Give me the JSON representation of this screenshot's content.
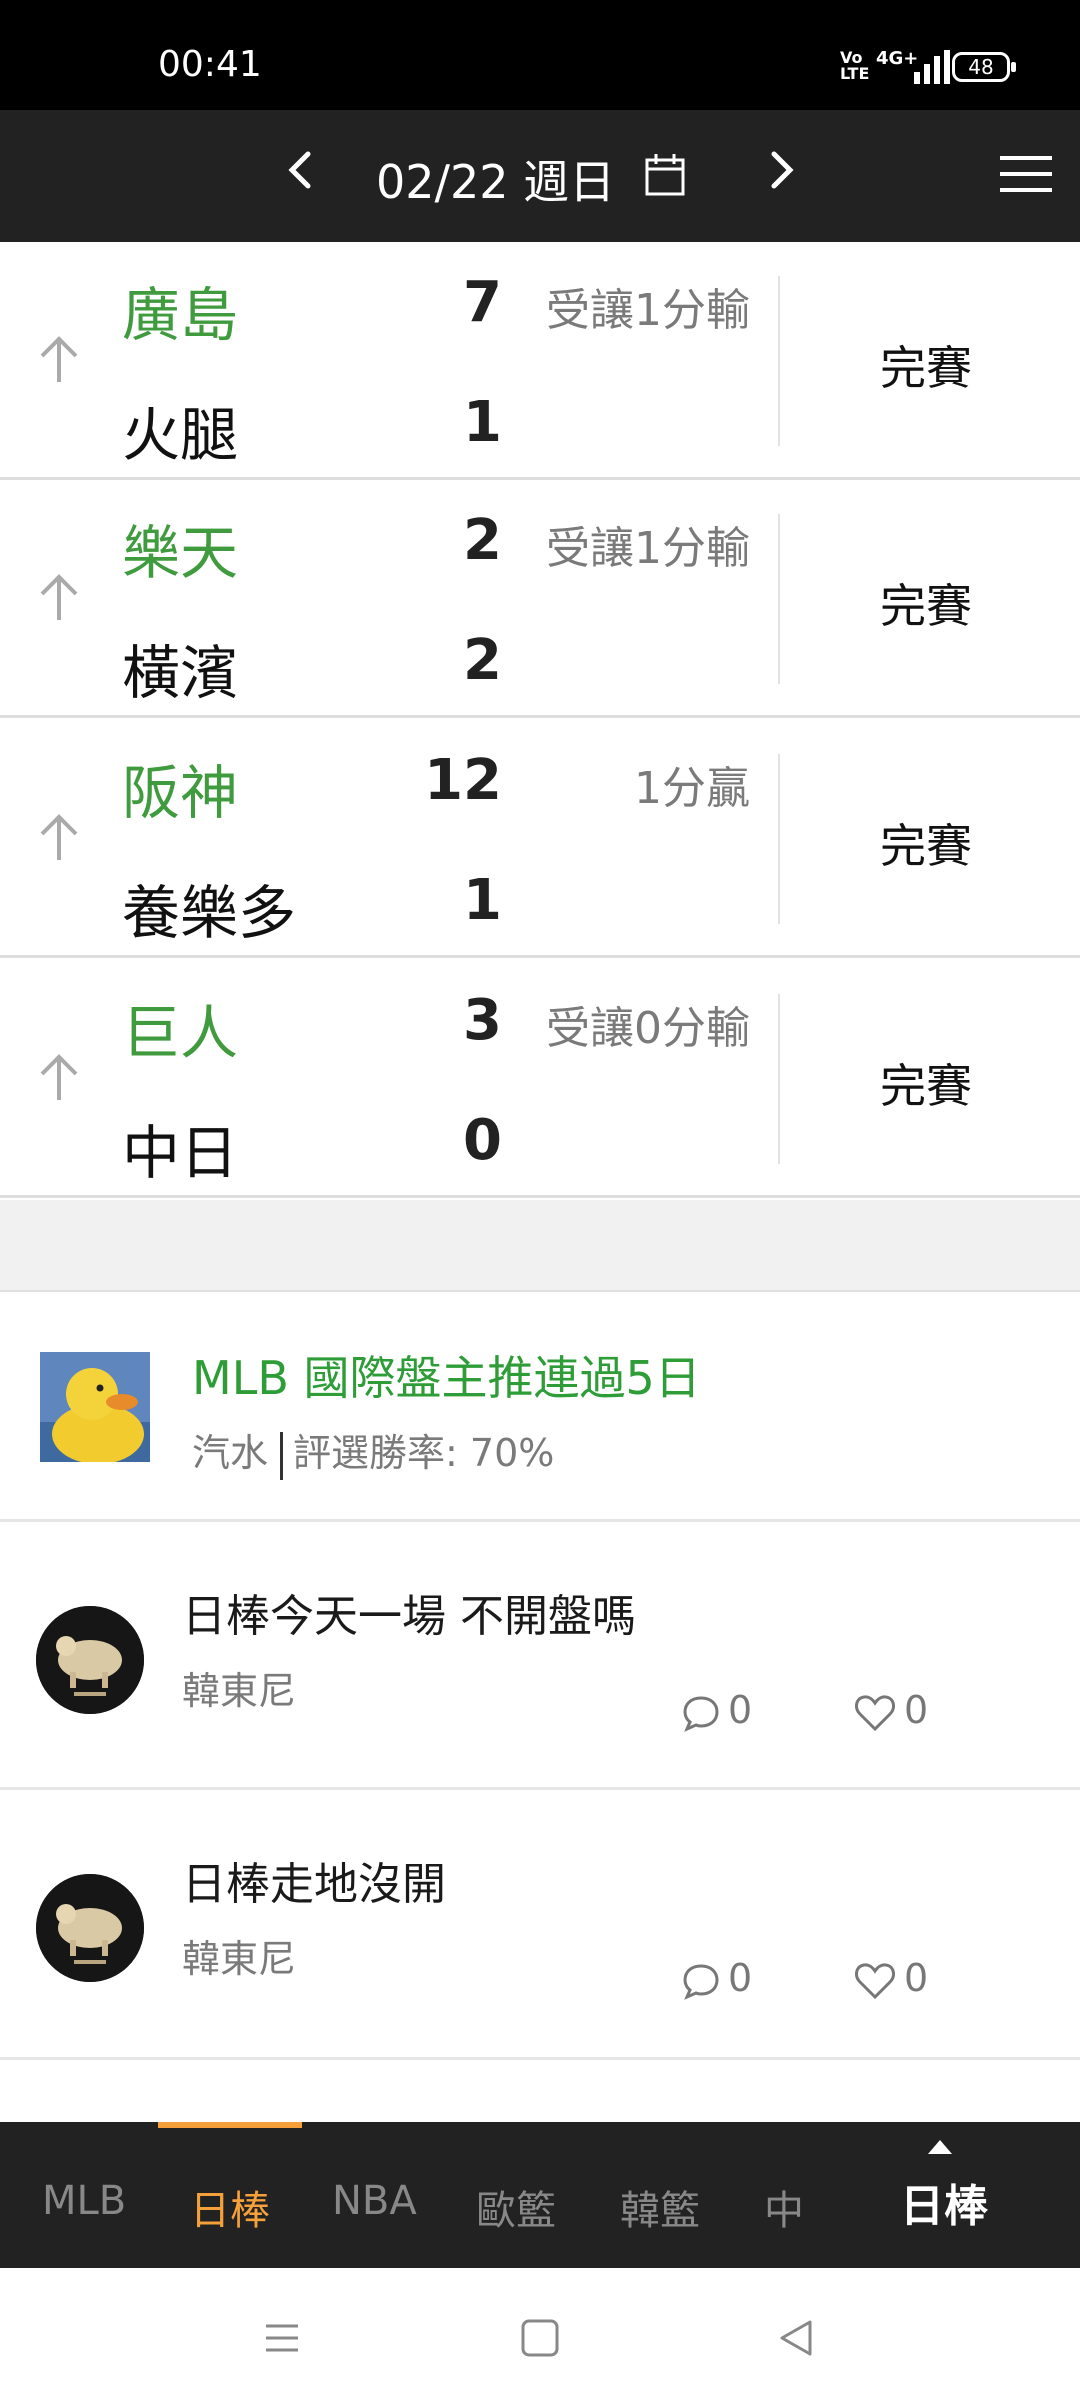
{
  "status_bar": {
    "time": "00:41",
    "volte": "Vo LTE",
    "network": "4G+",
    "battery": "48"
  },
  "header": {
    "date": "02/22 週日"
  },
  "games": [
    {
      "team1": "廣島",
      "score1": "7",
      "team2": "火腿",
      "score2": "1",
      "handicap": "受讓1分輸",
      "status": "完賽"
    },
    {
      "team1": "樂天",
      "score1": "2",
      "team2": "橫濱",
      "score2": "2",
      "handicap": "受讓1分輸",
      "status": "完賽"
    },
    {
      "team1": "阪神",
      "score1": "12",
      "team2": "養樂多",
      "score2": "1",
      "handicap": "1分贏",
      "status": "完賽"
    },
    {
      "team1": "巨人",
      "score1": "3",
      "team2": "中日",
      "score2": "0",
      "handicap": "受讓0分輸",
      "status": "完賽"
    }
  ],
  "promo": {
    "title": "MLB 國際盤主推連過5日",
    "author": "汽水",
    "win_rate": "評選勝率: 70%"
  },
  "posts": [
    {
      "title": "日棒今天一場 不開盤嗎",
      "author": "韓東尼",
      "comments": "0",
      "likes": "0"
    },
    {
      "title": "日棒走地沒開",
      "author": "韓東尼",
      "comments": "0",
      "likes": "0"
    }
  ],
  "tabs": [
    "MLB",
    "日棒",
    "NBA",
    "歐籃",
    "韓籃",
    "中"
  ],
  "active_tab": "日棒",
  "current_league": "日棒",
  "colors": {
    "accent": "#f5a03a",
    "team_green": "#3f9b3d",
    "header_bg": "#222222"
  }
}
